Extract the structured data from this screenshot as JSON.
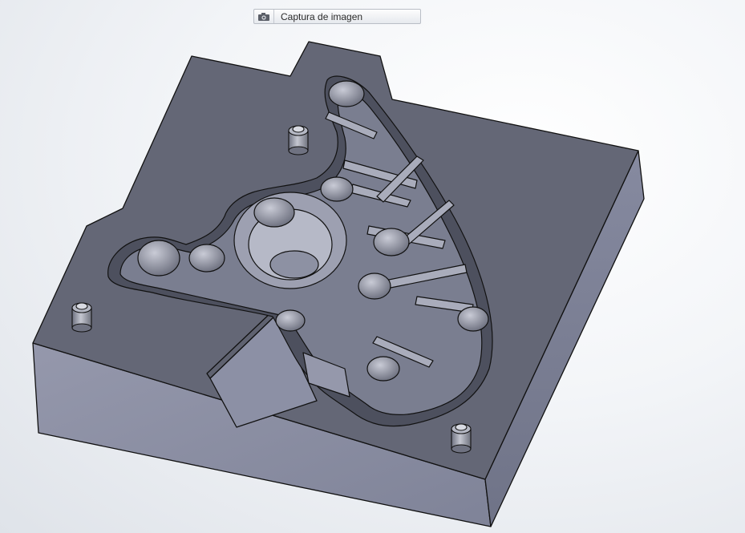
{
  "toolbar": {
    "capture_label": "Captura de imagen",
    "capture_icon": "camera-icon"
  },
  "colors": {
    "background_light": "#ffffff",
    "background_shadow": "#dfe3e9",
    "mold_top": "#646776",
    "mold_side_front": "#8e92a6",
    "mold_side_right": "#7c8095",
    "edge": "#111111"
  }
}
